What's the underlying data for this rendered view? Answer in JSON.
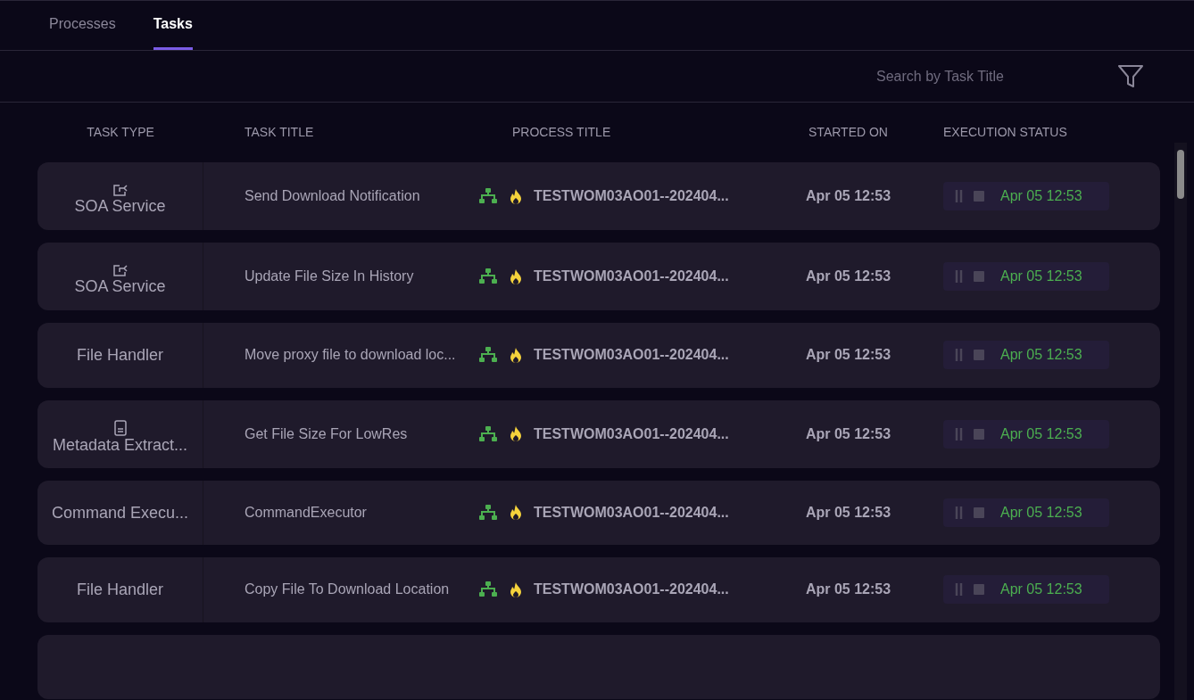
{
  "tabs": [
    {
      "label": "Processes",
      "selected": false
    },
    {
      "label": "Tasks",
      "selected": true
    }
  ],
  "search": {
    "placeholder": "Search by Task Title"
  },
  "columns": [
    "TASK TYPE",
    "TASK TITLE",
    "PROCESS TITLE",
    "STARTED ON",
    "EXECUTION STATUS"
  ],
  "rows": [
    {
      "task_type": "SOA Service",
      "kind": "export",
      "task_title": "Send Download Notification",
      "process_title": "TESTWOM03AO01--202404...",
      "started_on": "Apr 05 12:53",
      "status_time": "Apr 05 12:53"
    },
    {
      "task_type": "SOA Service",
      "kind": "export",
      "task_title": "Update File Size In History",
      "process_title": "TESTWOM03AO01--202404...",
      "started_on": "Apr 05 12:53",
      "status_time": "Apr 05 12:53"
    },
    {
      "task_type": "File Handler",
      "kind": "plain",
      "task_title": "Move proxy file to download loc...",
      "process_title": "TESTWOM03AO01--202404...",
      "started_on": "Apr 05 12:53",
      "status_time": "Apr 05 12:53"
    },
    {
      "task_type": "Metadata Extract...",
      "kind": "document",
      "task_title": "Get File Size For LowRes",
      "process_title": "TESTWOM03AO01--202404...",
      "started_on": "Apr 05 12:53",
      "status_time": "Apr 05 12:53"
    },
    {
      "task_type": "Command Execu...",
      "kind": "plain",
      "task_title": "CommandExecutor",
      "process_title": "TESTWOM03AO01--202404...",
      "started_on": "Apr 05 12:53",
      "status_time": "Apr 05 12:53"
    },
    {
      "task_type": "File Handler",
      "kind": "plain",
      "task_title": "Copy File To Download Location",
      "process_title": "TESTWOM03AO01--202404...",
      "started_on": "Apr 05 12:53",
      "status_time": "Apr 05 12:53"
    }
  ]
}
